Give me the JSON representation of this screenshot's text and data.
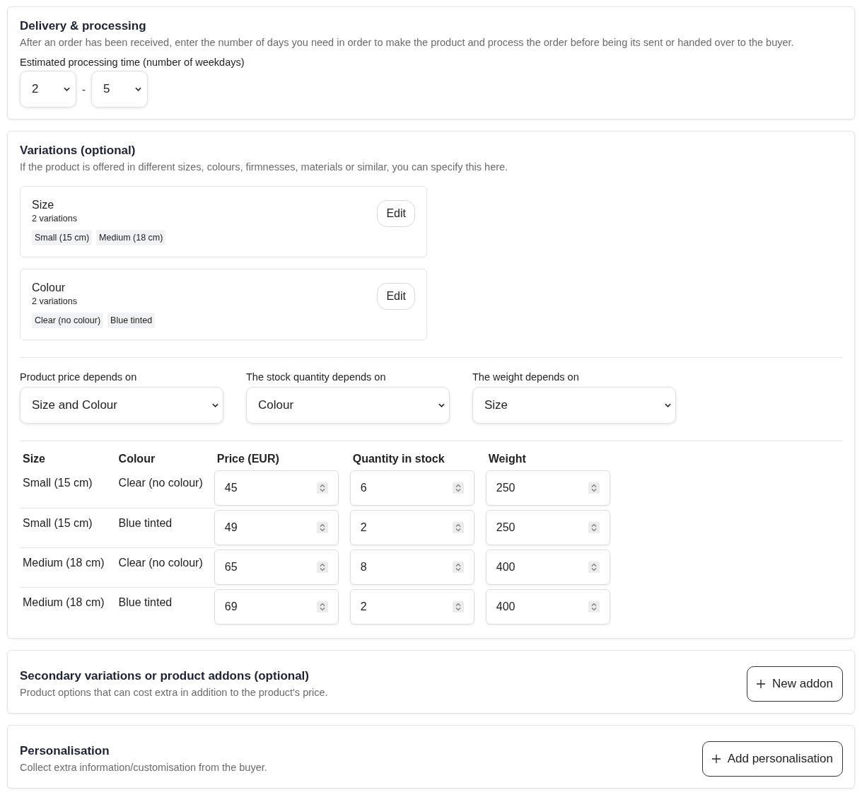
{
  "delivery": {
    "title": "Delivery & processing",
    "description": "After an order has been received, enter the number of days you need in order to make the product and process the order before being its sent or handed over to the buyer.",
    "label": "Estimated processing time (number of weekdays)",
    "min_value": "2",
    "separator": "-",
    "max_value": "5"
  },
  "variations": {
    "title": "Variations (optional)",
    "description": "If the product is offered in different sizes, colours, firmnesses, materials or similar, you can specify this here.",
    "groups": [
      {
        "name": "Size",
        "count": "2 variations",
        "options": [
          "Small (15 cm)",
          "Medium (18 cm)"
        ],
        "edit_label": "Edit"
      },
      {
        "name": "Colour",
        "count": "2 variations",
        "options": [
          "Clear (no colour)",
          "Blue tinted"
        ],
        "edit_label": "Edit"
      }
    ],
    "dependencies": [
      {
        "label": "Product price depends on",
        "value": "Size and Colour"
      },
      {
        "label": "The stock quantity depends on",
        "value": "Colour"
      },
      {
        "label": "The weight depends on",
        "value": "Size"
      }
    ],
    "table": {
      "columns": [
        "Size",
        "Colour",
        "Price (EUR)",
        "Quantity in stock",
        "Weight"
      ],
      "rows": [
        {
          "size": "Small (15 cm)",
          "colour": "Clear (no colour)",
          "price": "45",
          "quantity": "6",
          "weight": "250"
        },
        {
          "size": "Small (15 cm)",
          "colour": "Blue tinted",
          "price": "49",
          "quantity": "2",
          "weight": "250"
        },
        {
          "size": "Medium (18 cm)",
          "colour": "Clear (no colour)",
          "price": "65",
          "quantity": "8",
          "weight": "400"
        },
        {
          "size": "Medium (18 cm)",
          "colour": "Blue tinted",
          "price": "69",
          "quantity": "2",
          "weight": "400"
        }
      ]
    }
  },
  "addons": {
    "title": "Secondary variations or product addons (optional)",
    "description": "Product options that can cost extra in addition to the product's price.",
    "button": "New addon"
  },
  "personalisation": {
    "title": "Personalisation",
    "description": "Collect extra information/customisation from the buyer.",
    "button": "Add personalisation"
  }
}
